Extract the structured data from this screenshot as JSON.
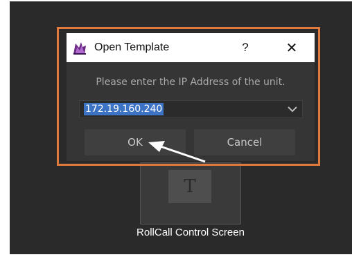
{
  "dialog": {
    "title": "Open Template",
    "help_label": "?",
    "close_label": "✕",
    "prompt": "Please enter the IP Address of the unit.",
    "ip_value": "172.19.160.240",
    "ok_label": "OK",
    "cancel_label": "Cancel"
  },
  "background": {
    "tile_icon_text": "T",
    "tile_label": "RollCall Control Screen"
  },
  "colors": {
    "highlight": "#e07b3f",
    "selection": "#3c73c4",
    "dialog_bg": "#353535"
  },
  "icons": {
    "app": "app-icon",
    "dropdown": "chevron-down-icon",
    "pointer": "arrow-pointer-icon"
  }
}
